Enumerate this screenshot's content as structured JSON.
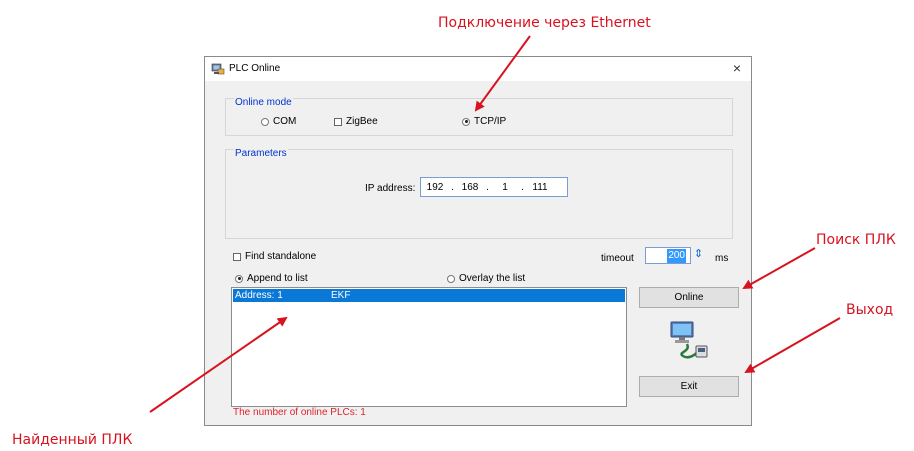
{
  "annotations": {
    "ethernet": "Подключение через Ethernet",
    "search": "Поиск ПЛК",
    "exit": "Выход",
    "found": "Найденный ПЛК"
  },
  "dialog": {
    "title": "PLC Online",
    "close": "×",
    "online_mode": {
      "label": "Online mode",
      "options": [
        "COM",
        "ZigBee",
        "TCP/IP"
      ],
      "selected": "TCP/IP"
    },
    "parameters": {
      "label": "Parameters",
      "ip_label": "IP address:",
      "ip": [
        "192",
        "168",
        "1",
        "111"
      ],
      "ip_separator": "."
    },
    "find_standalone": "Find standalone",
    "timeout_label": "timeout",
    "timeout_value": "200",
    "timeout_unit": "ms",
    "list_mode": {
      "options": [
        "Append to list",
        "Overlay the list"
      ],
      "selected": "Append to list"
    },
    "list": [
      {
        "address": "Address: 1",
        "name": "EKF",
        "selected": true
      }
    ],
    "buttons": {
      "online": "Online",
      "exit": "Exit"
    },
    "status": "The number of online PLCs: 1"
  },
  "colors": {
    "annotation_red": "#d8121f",
    "group_label_blue": "#0033cc",
    "selection_blue": "#0a78d7",
    "status_red": "#e0242d"
  },
  "icons": {
    "title": "plc-app-icon",
    "online": "network-computer-icon"
  }
}
